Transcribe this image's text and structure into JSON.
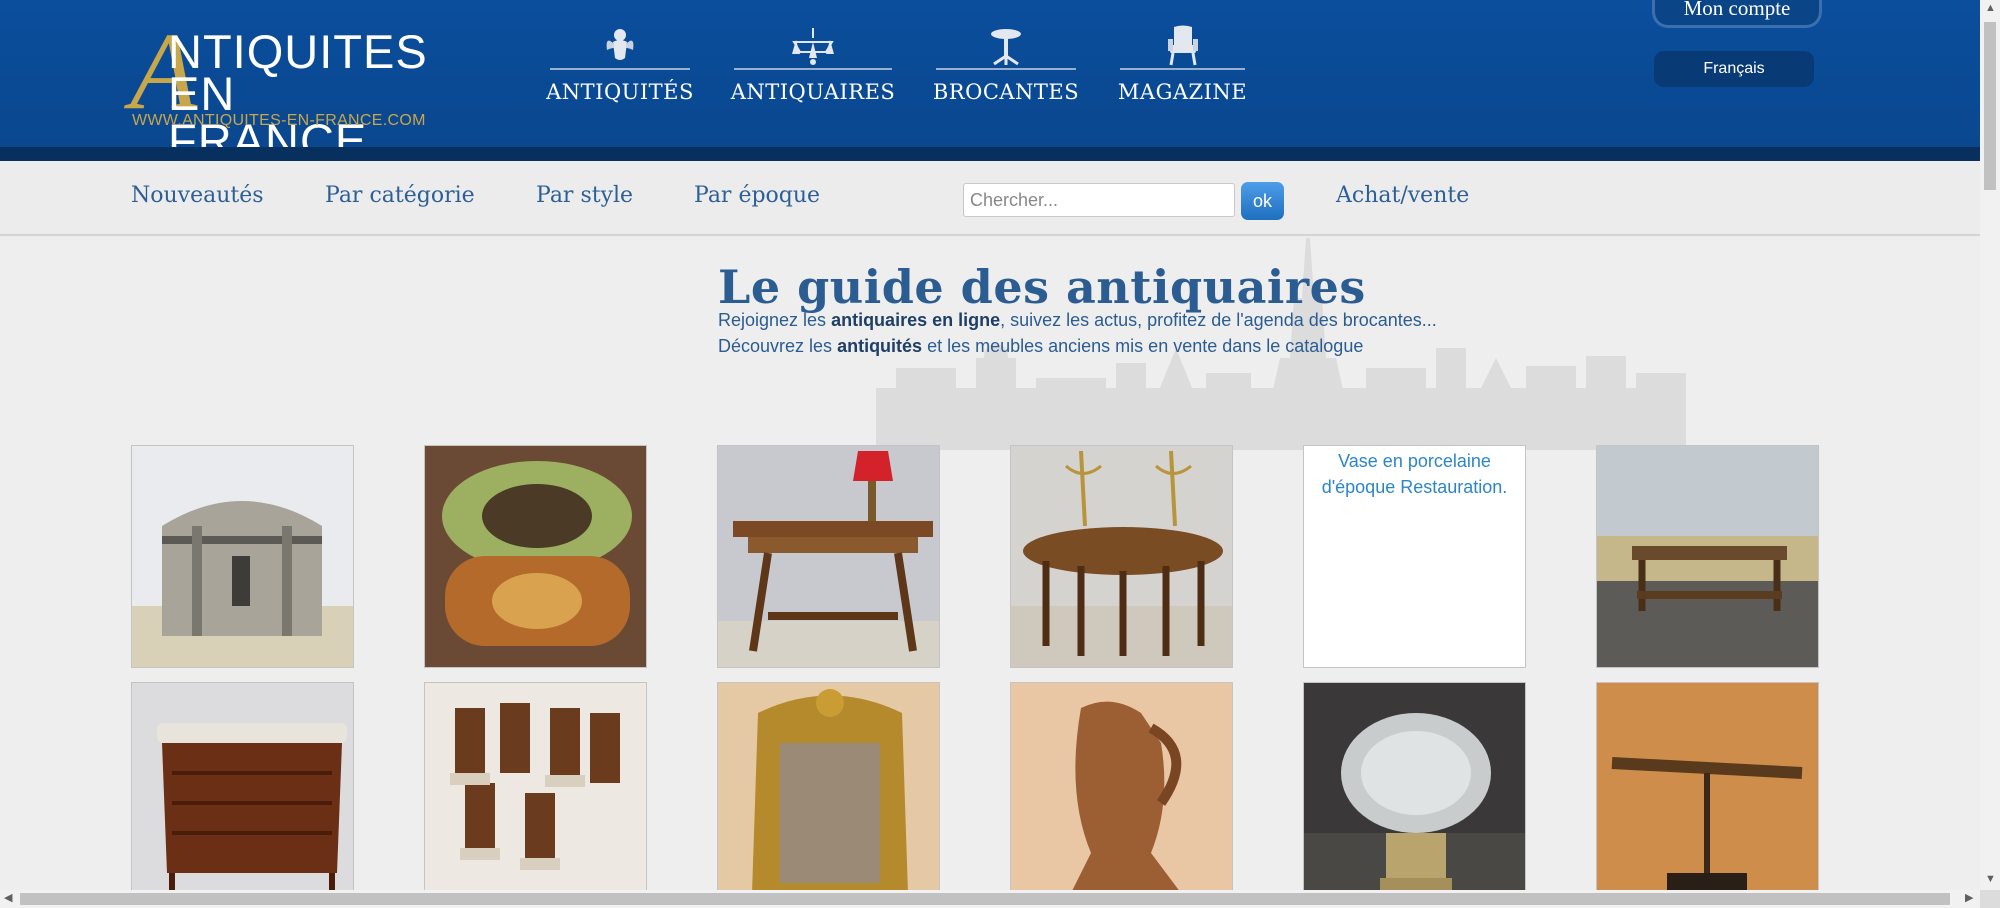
{
  "logo": {
    "letter": "A",
    "line1": "NTIQUITES",
    "line2": "EN FRANCE",
    "url": "WWW.ANTIQUITES-EN-FRANCE.COM"
  },
  "main_nav": [
    {
      "label": "ANTIQUITÉS",
      "icon": "cherub-icon"
    },
    {
      "label": "ANTIQUAIRES",
      "icon": "chandelier-icon"
    },
    {
      "label": "BROCANTES",
      "icon": "pedestal-table-icon"
    },
    {
      "label": "MAGAZINE",
      "icon": "armchair-icon"
    }
  ],
  "account": {
    "label": "Mon compte"
  },
  "language": {
    "selected": "Français"
  },
  "sub_nav": {
    "links": [
      "Nouveautés",
      "Par catégorie",
      "Par style",
      "Par époque"
    ],
    "search_placeholder": "Chercher...",
    "search_button": "ok",
    "extra_link": "Achat/vente"
  },
  "guide": {
    "title": "Le guide des antiquaires",
    "line1_pre": "Rejoignez les ",
    "line1_bold": "antiquaires en ligne",
    "line1_post": ", suivez les actus, profitez de l'agenda des brocantes...",
    "line2_pre": "Découvrez les ",
    "line2_bold": "antiquités",
    "line2_post": " et les meubles anciens mis en vente dans le catalogue"
  },
  "products": [
    {
      "name": "dome-chest-image",
      "alt": ""
    },
    {
      "name": "painted-jewelry-box-image",
      "alt": ""
    },
    {
      "name": "walnut-side-table-image",
      "alt": ""
    },
    {
      "name": "oval-gateleg-table-image",
      "alt": ""
    },
    {
      "name": "porcelain-vase-image",
      "alt": "Vase en porcelaine d'époque Restauration."
    },
    {
      "name": "low-wooden-table-image",
      "alt": ""
    },
    {
      "name": "demilune-cabinet-image",
      "alt": ""
    },
    {
      "name": "art-deco-chairs-image",
      "alt": ""
    },
    {
      "name": "gilded-mirror-image",
      "alt": ""
    },
    {
      "name": "carved-wood-pitcher-image",
      "alt": ""
    },
    {
      "name": "crystal-vase-image",
      "alt": ""
    },
    {
      "name": "brass-telescope-image",
      "alt": ""
    }
  ],
  "colors": {
    "header_blue": "#0b4e9c",
    "link_blue": "#2d5f97",
    "gold": "#c8a64a"
  }
}
